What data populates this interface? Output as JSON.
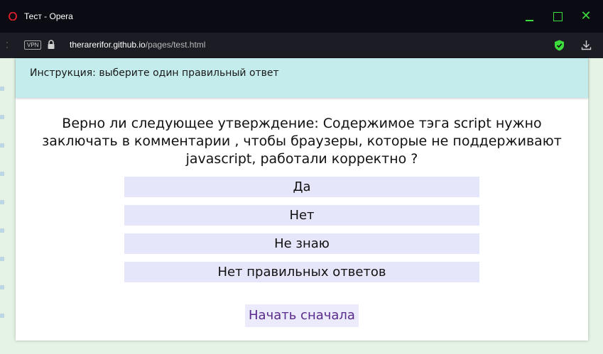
{
  "window": {
    "title": "Тест - Opera"
  },
  "addressbar": {
    "vpn_label": "VPN",
    "url_host": "therarerifor.github.io",
    "url_path": "/pages/test.html"
  },
  "colors": {
    "accent": "#3ddc3d",
    "instruction_bg": "#c4ecec",
    "answer_bg": "#e6e6fb",
    "restart_text": "#5a2a8c"
  },
  "icons": [
    "opera-icon",
    "minimize-icon",
    "maximize-icon",
    "close-icon",
    "lock-icon",
    "shield-check-icon",
    "download-icon"
  ],
  "quiz": {
    "instruction": "Инструкция: выберите один правильный ответ",
    "question": "Верно ли следующее утверждение: Содержимое тэга script нужно заключать в комментарии , чтобы браузеры, которые не поддерживают javascript, работали корректно ?",
    "answers": [
      "Да",
      "Нет",
      "Не знаю",
      "Нет правильных ответов"
    ],
    "restart_label": "Начать сначала"
  }
}
